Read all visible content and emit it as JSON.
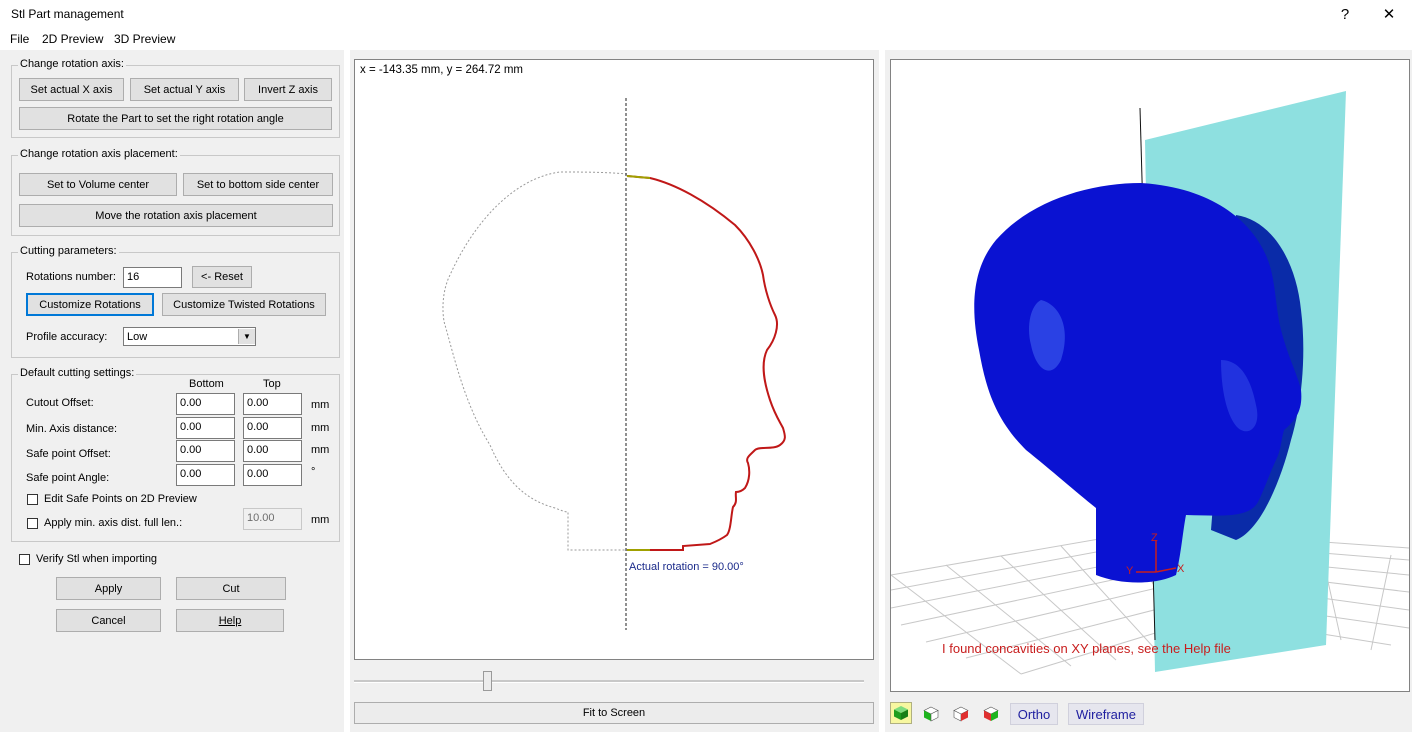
{
  "window": {
    "title": "Stl Part management",
    "help_glyph": "?",
    "close_glyph": "✕"
  },
  "menu": [
    "File",
    "2D Preview",
    "3D Preview"
  ],
  "rotation_axis": {
    "title": "Change rotation axis:",
    "set_x": "Set actual X axis",
    "set_y": "Set actual Y axis",
    "invert_z": "Invert Z axis",
    "rotate_part": "Rotate the Part to set the right rotation angle"
  },
  "axis_placement": {
    "title": "Change rotation axis placement:",
    "volume_center": "Set to Volume center",
    "bottom_center": "Set to bottom side center",
    "move_axis": "Move the rotation axis placement"
  },
  "cutting": {
    "title": "Cutting parameters:",
    "rotations_label": "Rotations number:",
    "rotations_value": "16",
    "reset": "<- Reset",
    "customize": "Customize Rotations",
    "customize_twisted": "Customize Twisted Rotations",
    "accuracy_label": "Profile accuracy:",
    "accuracy_value": "Low"
  },
  "defaults": {
    "title": "Default cutting settings:",
    "col_bottom": "Bottom",
    "col_top": "Top",
    "rows": [
      {
        "label": "Cutout Offset:",
        "bottom": "0.00",
        "top": "0.00",
        "unit": "mm"
      },
      {
        "label": "Min. Axis distance:",
        "bottom": "0.00",
        "top": "0.00",
        "unit": "mm"
      },
      {
        "label": "Safe point Offset:",
        "bottom": "0.00",
        "top": "0.00",
        "unit": "mm"
      },
      {
        "label": "Safe point Angle:",
        "bottom": "0.00",
        "top": "0.00",
        "unit": "°"
      }
    ],
    "edit_safe_points": "Edit Safe Points on 2D Preview",
    "apply_min_axis": "Apply min. axis dist. full len.:",
    "min_axis_value": "10.00",
    "min_axis_unit": "mm"
  },
  "verify_stl": "Verify Stl when importing",
  "buttons": {
    "apply": "Apply",
    "cut": "Cut",
    "cancel": "Cancel",
    "help": "Help"
  },
  "preview2d": {
    "coords": "x = -143.35 mm, y = 264.72 mm",
    "rotation": "Actual rotation = 90.00°",
    "slider_value": 0.26,
    "fit_screen": "Fit to Screen"
  },
  "preview3d": {
    "warning": "I found concavities on XY planes, see the Help file",
    "axis_x": "X",
    "axis_y": "Y",
    "axis_z": "Z",
    "ortho": "Ortho",
    "wireframe": "Wireframe"
  },
  "colors": {
    "head": "#0a12d2",
    "plane": "#8ee0e0",
    "profile": "#c01818",
    "warning": "#c81e1e"
  }
}
